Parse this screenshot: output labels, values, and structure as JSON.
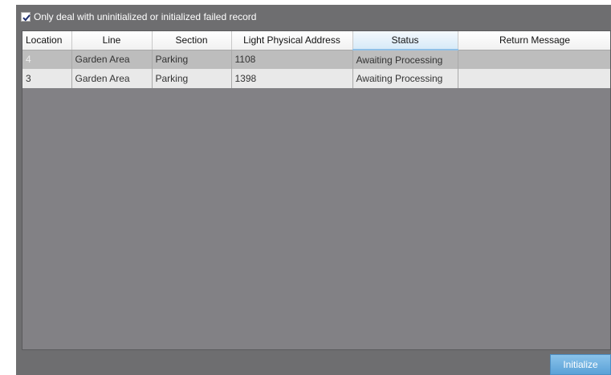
{
  "filter": {
    "checked": true,
    "label": "Only deal with uninitialized or initialized failed record"
  },
  "table": {
    "columns": [
      "Location",
      "Line",
      "Section",
      "Light Physical Address",
      "Status",
      "Return Message"
    ],
    "sorted_column": "Status",
    "rows": [
      [
        "4",
        "Garden Area",
        "Parking",
        "1108",
        "Awaiting Processing",
        ""
      ],
      [
        "3",
        "Garden Area",
        "Parking",
        "1398",
        "Awaiting Processing",
        ""
      ]
    ]
  },
  "actions": {
    "initialize_label": "Initialize"
  },
  "colors": {
    "panel_background": "#6e6e70",
    "grid_background": "#828185",
    "button_accent": "#6fb1e0",
    "active_header": "#d7eaf8"
  }
}
